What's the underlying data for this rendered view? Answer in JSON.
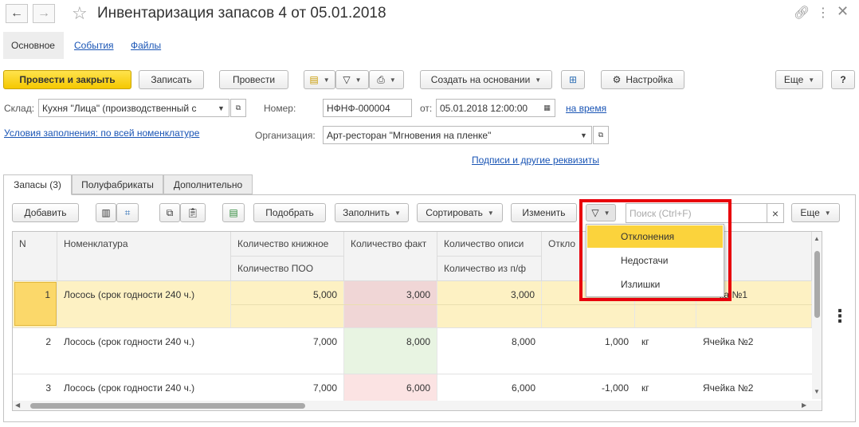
{
  "header": {
    "title": "Инвентаризация запасов 4 от 05.01.2018"
  },
  "tabs": [
    "Основное",
    "События",
    "Файлы"
  ],
  "toolbar": {
    "post_close": "Провести и закрыть",
    "save": "Записать",
    "post": "Провести",
    "create_based": "Создать на основании",
    "settings": "Настройка",
    "more": "Еще",
    "help": "?"
  },
  "form": {
    "warehouse_label": "Склад:",
    "warehouse_value": "Кухня \"Лица\" (производственный с",
    "number_label": "Номер:",
    "number_value": "НФНФ-000004",
    "date_label": "от:",
    "date_value": "05.01.2018 12:00:00",
    "on_time_link": "на время",
    "fill_conditions_link": "Условия заполнения: по всей номенклатуре",
    "org_label": "Организация:",
    "org_value": "Арт-ресторан \"Мгновения на пленке\"",
    "signatures_link": "Подписи и другие реквизиты"
  },
  "page_tabs": [
    "Запасы (3)",
    "Полуфабрикаты",
    "Дополнительно"
  ],
  "table_toolbar": {
    "add": "Добавить",
    "pick": "Подобрать",
    "fill": "Заполнить",
    "sort": "Сортировать",
    "change": "Изменить",
    "search_placeholder": "Поиск (Ctrl+F)",
    "clear": "×",
    "more": "Еще"
  },
  "table": {
    "headers_top": [
      "N",
      "Номенклатура",
      "Количество книжное",
      "Количество факт",
      "Количество описи",
      "Откло",
      "",
      "а"
    ],
    "headers_bottom": [
      "Количество ПОО",
      "Количество из п/ф"
    ],
    "rows": [
      {
        "n": "1",
        "name": "Лосось (срок годности 240 ч.)",
        "book": "5,000",
        "fact": "3,000",
        "inv": "3,000",
        "dev": "",
        "unit": "",
        "cell": "ка №1"
      },
      {
        "n": "2",
        "name": "Лосось (срок годности 240 ч.)",
        "book": "7,000",
        "fact": "8,000",
        "inv": "8,000",
        "dev": "1,000",
        "unit": "кг",
        "cell": "Ячейка №2"
      },
      {
        "n": "3",
        "name": "Лосось (срок годности 240 ч.)",
        "book": "7,000",
        "fact": "6,000",
        "inv": "6,000",
        "dev": "-1,000",
        "unit": "кг",
        "cell": "Ячейка №2"
      }
    ]
  },
  "filter_menu": {
    "items": [
      "Отклонения",
      "Недостачи",
      "Излишки"
    ],
    "selected": "Отклонения"
  },
  "colors": {
    "primary": "#f5c800",
    "selected_row": "#fdf1c3",
    "fact_red": "#f0d6d6",
    "fact_green": "#e8f4e2",
    "highlight": "#e8000b",
    "link": "#1a55b5"
  }
}
